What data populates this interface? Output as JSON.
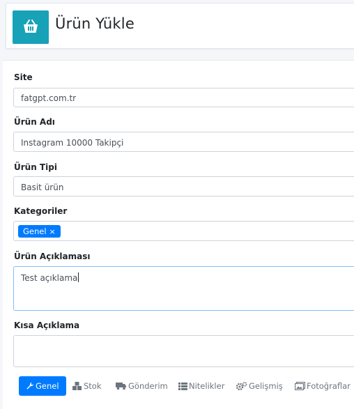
{
  "header": {
    "title": "Ürün Yükle",
    "icon": "basket-icon",
    "icon_bg": "#17a2b8"
  },
  "form": {
    "site": {
      "label": "Site",
      "value": "fatgpt.com.tr"
    },
    "product_name": {
      "label": "Ürün Adı",
      "value": "Instagram 10000 Takipçi"
    },
    "product_type": {
      "label": "Ürün Tipi",
      "value": "Basit ürün"
    },
    "categories": {
      "label": "Kategoriler",
      "tags": [
        "Genel"
      ],
      "remove_symbol": "×"
    },
    "description": {
      "label": "Ürün Açıklaması",
      "value": "Test açıklama"
    },
    "short_description": {
      "label": "Kısa Açıklama",
      "value": ""
    }
  },
  "tabs": [
    {
      "label": "Genel",
      "icon": "wrench-icon",
      "active": true
    },
    {
      "label": "Stok",
      "icon": "boxes-icon",
      "active": false
    },
    {
      "label": "Gönderim",
      "icon": "truck-icon",
      "active": false
    },
    {
      "label": "Nitelikler",
      "icon": "list-icon",
      "active": false
    },
    {
      "label": "Gelişmiş",
      "icon": "gears-icon",
      "active": false
    },
    {
      "label": "Fotoğraflar",
      "icon": "images-icon",
      "active": false
    }
  ],
  "colors": {
    "primary": "#007bff",
    "focus_border": "#80bdff",
    "muted": "#6c757d"
  }
}
